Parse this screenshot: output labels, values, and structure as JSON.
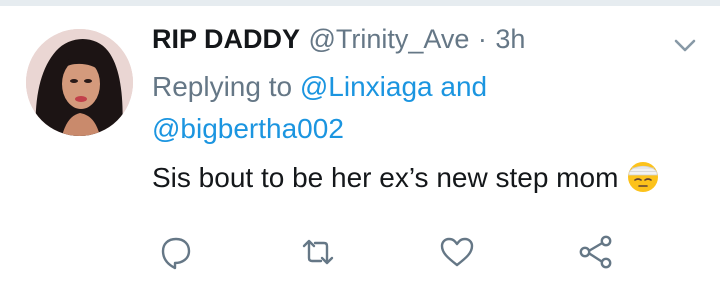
{
  "tweet": {
    "display_name": "RIP DADDY",
    "handle": "@Trinity_Ave",
    "separator": "·",
    "time": "3h",
    "replying_prefix": "Replying to",
    "reply_mention_1": "@Linxiaga",
    "reply_and": "and",
    "reply_mention_2": "@bigbertha002",
    "text": "Sis bout to be her ex’s new step mom",
    "emoji": "face-with-head-bandage"
  },
  "icons": {
    "menu": "chevron-down-icon",
    "reply": "reply-bubble-icon",
    "retweet": "retweet-icon",
    "like": "heart-icon",
    "share": "share-icon"
  },
  "colors": {
    "link": "#1b95e0",
    "secondary": "#657786",
    "primary_text": "#14171a",
    "icon": "#657786"
  }
}
